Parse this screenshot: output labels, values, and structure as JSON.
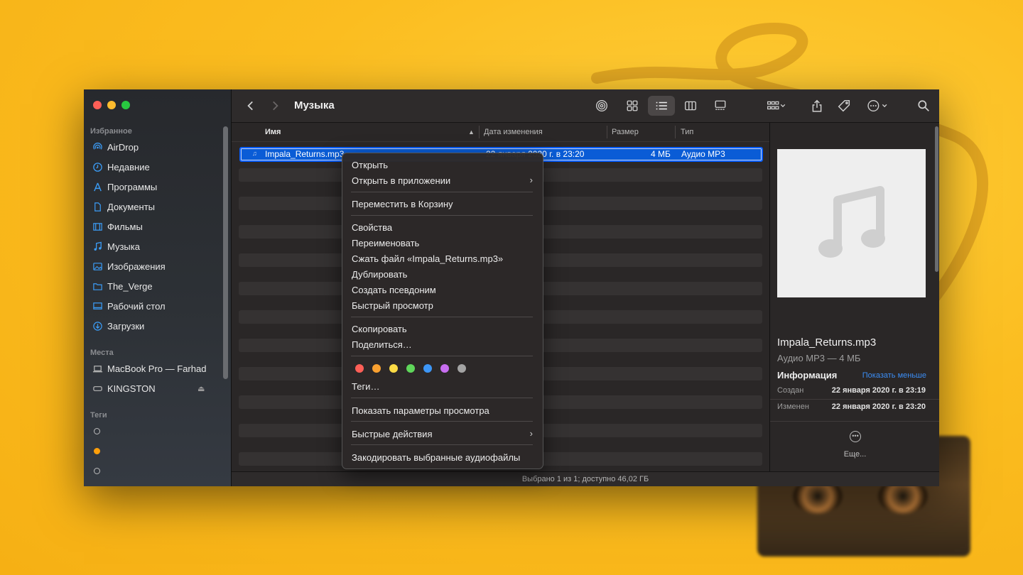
{
  "window": {
    "title": "Музыка",
    "traffic_lights": {
      "close": "#fe5f57",
      "minimize": "#febc2e",
      "zoom": "#28c840"
    }
  },
  "sidebar": {
    "favorites_title": "Избранное",
    "favorites": [
      {
        "label": "AirDrop",
        "icon": "airdrop-icon"
      },
      {
        "label": "Недавние",
        "icon": "clock-icon"
      },
      {
        "label": "Программы",
        "icon": "applications-icon"
      },
      {
        "label": "Документы",
        "icon": "document-icon"
      },
      {
        "label": "Фильмы",
        "icon": "film-icon"
      },
      {
        "label": "Музыка",
        "icon": "music-note-icon"
      },
      {
        "label": "Изображения",
        "icon": "photo-icon"
      },
      {
        "label": "The_Verge",
        "icon": "folder-icon"
      },
      {
        "label": "Рабочий стол",
        "icon": "desktop-icon"
      },
      {
        "label": "Загрузки",
        "icon": "download-icon"
      }
    ],
    "places_title": "Места",
    "places": [
      {
        "label": "MacBook Pro — Farhad",
        "icon": "laptop-icon"
      },
      {
        "label": "KINGSTON",
        "icon": "drive-icon"
      }
    ],
    "tags_title": "Теги",
    "tags": [
      {
        "color": "transparent"
      },
      {
        "color": "#ff9f0a"
      },
      {
        "color": "transparent"
      }
    ]
  },
  "toolbar": {
    "back": "chevron-left-icon",
    "forward": "chevron-right-icon",
    "title": "Музыка",
    "buttons": [
      "airdrop-icon",
      "icon-view-icon",
      "list-view-icon",
      "column-view-icon",
      "gallery-view-icon",
      "group-icon",
      "share-icon",
      "tag-icon",
      "more-icon",
      "search-icon"
    ]
  },
  "list": {
    "columns": {
      "name": "Имя",
      "date": "Дата изменения",
      "size": "Размер",
      "kind": "Тип"
    },
    "selected_file": {
      "name": "Impala_Returns.mp3",
      "date": "22 января 2020 г. в 23:20",
      "size": "4 МБ",
      "kind": "Аудио MP3"
    }
  },
  "context_menu": {
    "open": "Открыть",
    "open_with": "Открыть в приложении",
    "trash": "Переместить в Корзину",
    "info": "Свойства",
    "rename": "Переименовать",
    "compress": "Сжать файл «Impala_Returns.mp3»",
    "duplicate": "Дублировать",
    "alias": "Создать псевдоним",
    "quicklook": "Быстрый просмотр",
    "copy": "Скопировать",
    "share": "Поделиться…",
    "tag_colors": [
      "#fe5f57",
      "#f9a030",
      "#fddb45",
      "#5fd65a",
      "#3d96f6",
      "#c86ef0",
      "#a3a3a3"
    ],
    "tags": "Теги…",
    "view_options": "Показать параметры просмотра",
    "quick_actions": "Быстрые действия",
    "encode": "Закодировать выбранные аудиофайлы"
  },
  "preview": {
    "name": "Impala_Returns.mp3",
    "kind": "Аудио MP3 — 4 МБ",
    "info_title": "Информация",
    "show_less": "Показать меньше",
    "created_label": "Создан",
    "created_value": "22 января 2020 г. в 23:19",
    "modified_label": "Изменен",
    "modified_value": "22 января 2020 г. в 23:20",
    "more": "Еще..."
  },
  "status_bar": {
    "text": "Выбрано 1 из 1; доступно 46,02 ГБ"
  }
}
